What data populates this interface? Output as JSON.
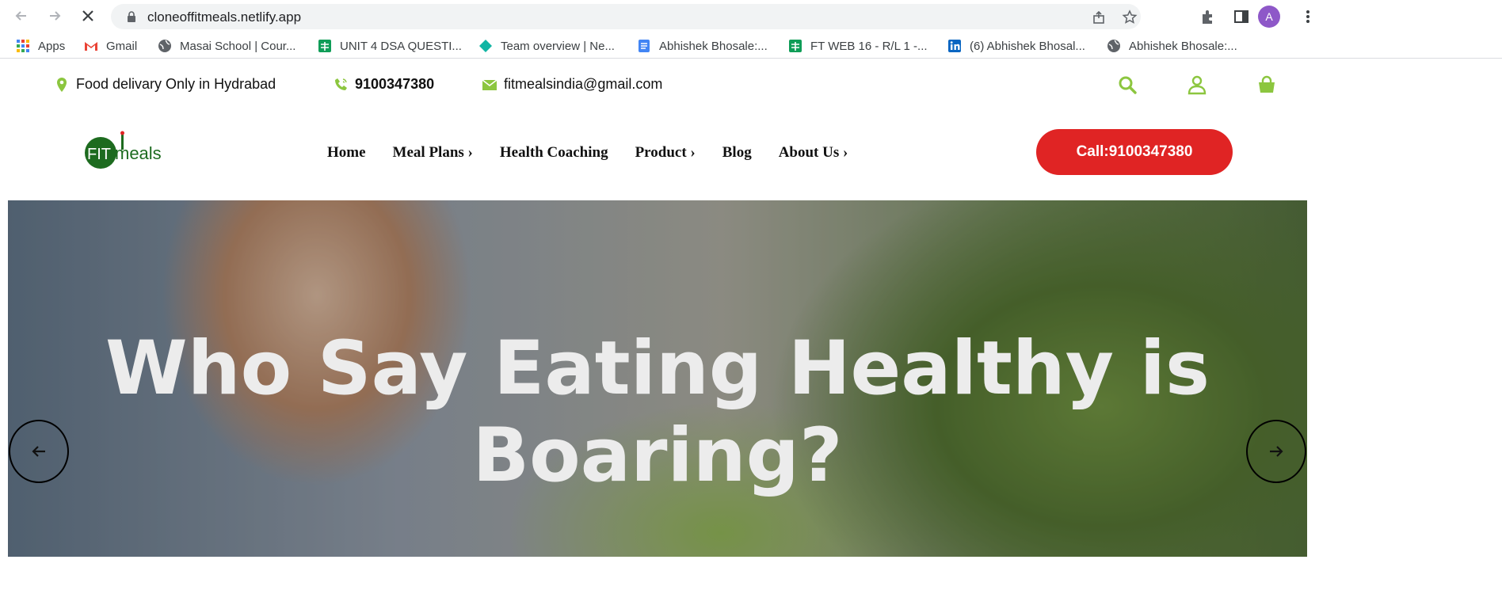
{
  "browser": {
    "url": "cloneoffitmeals.netlify.app",
    "profile_initial": "A",
    "bookmarks": [
      {
        "label": "Apps",
        "icon": "apps-grid-icon"
      },
      {
        "label": "Gmail",
        "icon": "gmail-icon"
      },
      {
        "label": "Masai School | Cour...",
        "icon": "globe-icon"
      },
      {
        "label": "UNIT 4 DSA QUESTI...",
        "icon": "sheets-icon"
      },
      {
        "label": "Team overview | Ne...",
        "icon": "diamond-icon"
      },
      {
        "label": "Abhishek Bhosale:...",
        "icon": "docs-icon"
      },
      {
        "label": "FT WEB 16 - R/L 1 -...",
        "icon": "sheets-icon"
      },
      {
        "label": "(6) Abhishek Bhosal...",
        "icon": "linkedin-icon"
      },
      {
        "label": "Abhishek Bhosale:...",
        "icon": "globe-icon"
      }
    ]
  },
  "topbar": {
    "delivery": "Food delivary Only in Hydrabad",
    "phone": "9100347380",
    "email": "fitmealsindia@gmail.com"
  },
  "header": {
    "logo_text": "FITmeals",
    "menu": [
      "Home",
      "Meal Plans ›",
      "Health Coaching",
      "Product ›",
      "Blog",
      "About Us ›"
    ],
    "call_button": "Call:9100347380"
  },
  "hero": {
    "title_line1": "Who Say Eating Healthy is",
    "title_line2": "Boaring?"
  },
  "colors": {
    "brand_green": "#8cc63f",
    "call_red": "#e02424",
    "logo_green": "#1d6b1f"
  }
}
